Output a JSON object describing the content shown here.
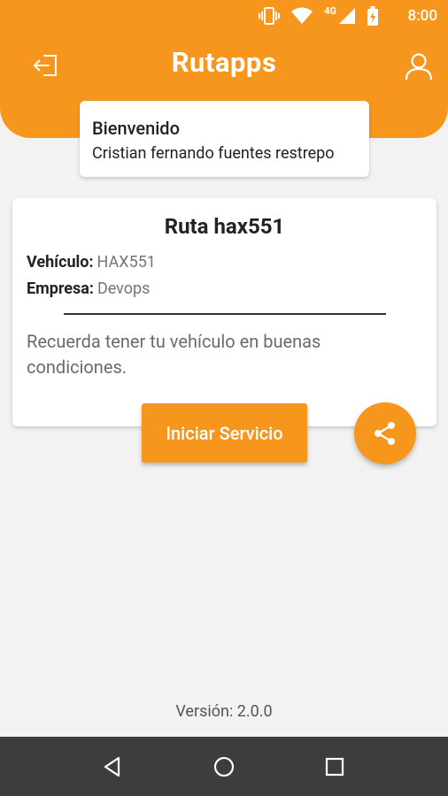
{
  "status_bar": {
    "time": "8:00",
    "network": "4G",
    "icons": [
      "vibrate-icon",
      "wifi-icon",
      "cell-signal-icon",
      "battery-icon"
    ]
  },
  "header": {
    "brand": "Rutapps",
    "color": "#f7961d",
    "left_icon": "logout-icon",
    "right_icon": "user-icon"
  },
  "welcome": {
    "title": "Bienvenido",
    "name": "Cristian fernando fuentes restrepo"
  },
  "route_card": {
    "title": "Ruta hax551",
    "vehicle_label": "Vehículo:",
    "vehicle_value": "HAX551",
    "company_label": "Empresa:",
    "company_value": "Devops",
    "note": "Recuerda tener tu vehículo en buenas condiciones."
  },
  "actions": {
    "start_label": "Iniciar Servicio",
    "share_icon": "share-icon"
  },
  "footer": {
    "version": "Versión: 2.0.0"
  },
  "nav_bar": {
    "icons": [
      "back-icon",
      "home-icon",
      "recents-icon"
    ]
  }
}
